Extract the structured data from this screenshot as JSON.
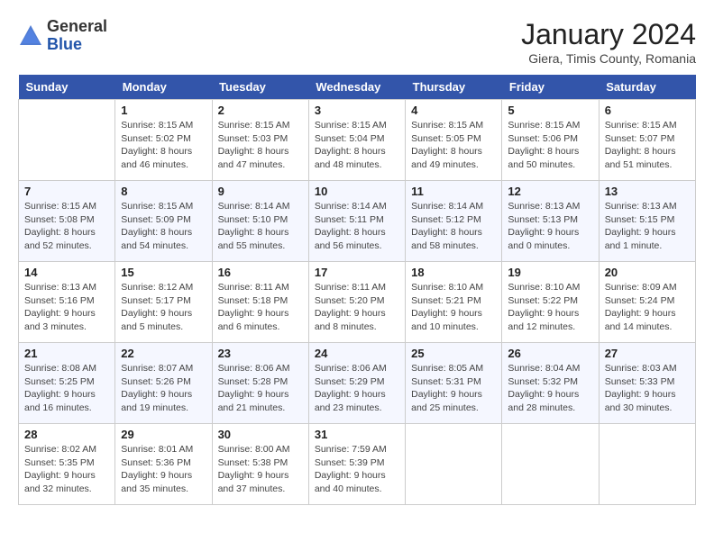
{
  "header": {
    "logo_general": "General",
    "logo_blue": "Blue",
    "month_title": "January 2024",
    "subtitle": "Giera, Timis County, Romania"
  },
  "weekdays": [
    "Sunday",
    "Monday",
    "Tuesday",
    "Wednesday",
    "Thursday",
    "Friday",
    "Saturday"
  ],
  "weeks": [
    [
      {
        "day": "",
        "sunrise": "",
        "sunset": "",
        "daylight": ""
      },
      {
        "day": "1",
        "sunrise": "Sunrise: 8:15 AM",
        "sunset": "Sunset: 5:02 PM",
        "daylight": "Daylight: 8 hours and 46 minutes."
      },
      {
        "day": "2",
        "sunrise": "Sunrise: 8:15 AM",
        "sunset": "Sunset: 5:03 PM",
        "daylight": "Daylight: 8 hours and 47 minutes."
      },
      {
        "day": "3",
        "sunrise": "Sunrise: 8:15 AM",
        "sunset": "Sunset: 5:04 PM",
        "daylight": "Daylight: 8 hours and 48 minutes."
      },
      {
        "day": "4",
        "sunrise": "Sunrise: 8:15 AM",
        "sunset": "Sunset: 5:05 PM",
        "daylight": "Daylight: 8 hours and 49 minutes."
      },
      {
        "day": "5",
        "sunrise": "Sunrise: 8:15 AM",
        "sunset": "Sunset: 5:06 PM",
        "daylight": "Daylight: 8 hours and 50 minutes."
      },
      {
        "day": "6",
        "sunrise": "Sunrise: 8:15 AM",
        "sunset": "Sunset: 5:07 PM",
        "daylight": "Daylight: 8 hours and 51 minutes."
      }
    ],
    [
      {
        "day": "7",
        "sunrise": "Sunrise: 8:15 AM",
        "sunset": "Sunset: 5:08 PM",
        "daylight": "Daylight: 8 hours and 52 minutes."
      },
      {
        "day": "8",
        "sunrise": "Sunrise: 8:15 AM",
        "sunset": "Sunset: 5:09 PM",
        "daylight": "Daylight: 8 hours and 54 minutes."
      },
      {
        "day": "9",
        "sunrise": "Sunrise: 8:14 AM",
        "sunset": "Sunset: 5:10 PM",
        "daylight": "Daylight: 8 hours and 55 minutes."
      },
      {
        "day": "10",
        "sunrise": "Sunrise: 8:14 AM",
        "sunset": "Sunset: 5:11 PM",
        "daylight": "Daylight: 8 hours and 56 minutes."
      },
      {
        "day": "11",
        "sunrise": "Sunrise: 8:14 AM",
        "sunset": "Sunset: 5:12 PM",
        "daylight": "Daylight: 8 hours and 58 minutes."
      },
      {
        "day": "12",
        "sunrise": "Sunrise: 8:13 AM",
        "sunset": "Sunset: 5:13 PM",
        "daylight": "Daylight: 9 hours and 0 minutes."
      },
      {
        "day": "13",
        "sunrise": "Sunrise: 8:13 AM",
        "sunset": "Sunset: 5:15 PM",
        "daylight": "Daylight: 9 hours and 1 minute."
      }
    ],
    [
      {
        "day": "14",
        "sunrise": "Sunrise: 8:13 AM",
        "sunset": "Sunset: 5:16 PM",
        "daylight": "Daylight: 9 hours and 3 minutes."
      },
      {
        "day": "15",
        "sunrise": "Sunrise: 8:12 AM",
        "sunset": "Sunset: 5:17 PM",
        "daylight": "Daylight: 9 hours and 5 minutes."
      },
      {
        "day": "16",
        "sunrise": "Sunrise: 8:11 AM",
        "sunset": "Sunset: 5:18 PM",
        "daylight": "Daylight: 9 hours and 6 minutes."
      },
      {
        "day": "17",
        "sunrise": "Sunrise: 8:11 AM",
        "sunset": "Sunset: 5:20 PM",
        "daylight": "Daylight: 9 hours and 8 minutes."
      },
      {
        "day": "18",
        "sunrise": "Sunrise: 8:10 AM",
        "sunset": "Sunset: 5:21 PM",
        "daylight": "Daylight: 9 hours and 10 minutes."
      },
      {
        "day": "19",
        "sunrise": "Sunrise: 8:10 AM",
        "sunset": "Sunset: 5:22 PM",
        "daylight": "Daylight: 9 hours and 12 minutes."
      },
      {
        "day": "20",
        "sunrise": "Sunrise: 8:09 AM",
        "sunset": "Sunset: 5:24 PM",
        "daylight": "Daylight: 9 hours and 14 minutes."
      }
    ],
    [
      {
        "day": "21",
        "sunrise": "Sunrise: 8:08 AM",
        "sunset": "Sunset: 5:25 PM",
        "daylight": "Daylight: 9 hours and 16 minutes."
      },
      {
        "day": "22",
        "sunrise": "Sunrise: 8:07 AM",
        "sunset": "Sunset: 5:26 PM",
        "daylight": "Daylight: 9 hours and 19 minutes."
      },
      {
        "day": "23",
        "sunrise": "Sunrise: 8:06 AM",
        "sunset": "Sunset: 5:28 PM",
        "daylight": "Daylight: 9 hours and 21 minutes."
      },
      {
        "day": "24",
        "sunrise": "Sunrise: 8:06 AM",
        "sunset": "Sunset: 5:29 PM",
        "daylight": "Daylight: 9 hours and 23 minutes."
      },
      {
        "day": "25",
        "sunrise": "Sunrise: 8:05 AM",
        "sunset": "Sunset: 5:31 PM",
        "daylight": "Daylight: 9 hours and 25 minutes."
      },
      {
        "day": "26",
        "sunrise": "Sunrise: 8:04 AM",
        "sunset": "Sunset: 5:32 PM",
        "daylight": "Daylight: 9 hours and 28 minutes."
      },
      {
        "day": "27",
        "sunrise": "Sunrise: 8:03 AM",
        "sunset": "Sunset: 5:33 PM",
        "daylight": "Daylight: 9 hours and 30 minutes."
      }
    ],
    [
      {
        "day": "28",
        "sunrise": "Sunrise: 8:02 AM",
        "sunset": "Sunset: 5:35 PM",
        "daylight": "Daylight: 9 hours and 32 minutes."
      },
      {
        "day": "29",
        "sunrise": "Sunrise: 8:01 AM",
        "sunset": "Sunset: 5:36 PM",
        "daylight": "Daylight: 9 hours and 35 minutes."
      },
      {
        "day": "30",
        "sunrise": "Sunrise: 8:00 AM",
        "sunset": "Sunset: 5:38 PM",
        "daylight": "Daylight: 9 hours and 37 minutes."
      },
      {
        "day": "31",
        "sunrise": "Sunrise: 7:59 AM",
        "sunset": "Sunset: 5:39 PM",
        "daylight": "Daylight: 9 hours and 40 minutes."
      },
      {
        "day": "",
        "sunrise": "",
        "sunset": "",
        "daylight": ""
      },
      {
        "day": "",
        "sunrise": "",
        "sunset": "",
        "daylight": ""
      },
      {
        "day": "",
        "sunrise": "",
        "sunset": "",
        "daylight": ""
      }
    ]
  ]
}
